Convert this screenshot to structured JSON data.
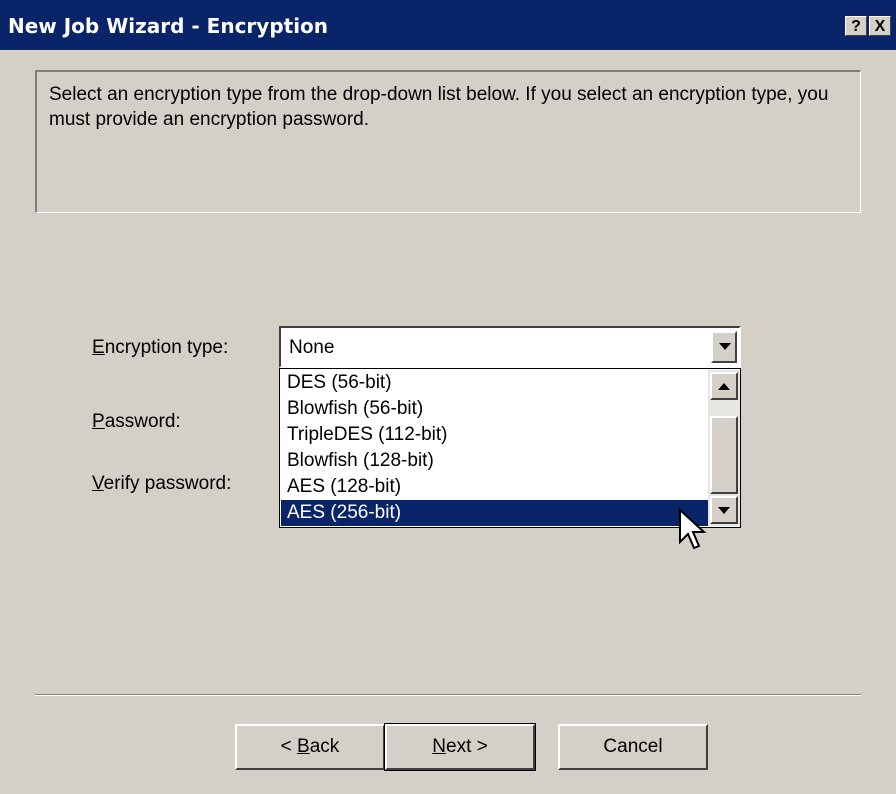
{
  "window": {
    "title": "New Job Wizard - Encryption",
    "help_glyph": "?",
    "close_glyph": "X"
  },
  "info_text": "Select an encryption type from the drop-down list below. If you select an encryption type, you must provide an encryption password.",
  "fields": {
    "encryption_type": {
      "mnemonic": "E",
      "rest": "ncryption type:"
    },
    "password": {
      "mnemonic": "P",
      "rest": "assword:"
    },
    "verify_password": {
      "mnemonic": "V",
      "rest": "erify password:"
    }
  },
  "combo": {
    "value": "None"
  },
  "dropdown": {
    "options": [
      "DES (56-bit)",
      "Blowfish (56-bit)",
      "TripleDES (112-bit)",
      "Blowfish (128-bit)",
      "AES (128-bit)",
      "AES (256-bit)"
    ],
    "highlighted": "AES (256-bit)"
  },
  "buttons": {
    "back": {
      "prefix": "< ",
      "mnemonic": "B",
      "rest": "ack"
    },
    "next": {
      "mnemonic": "N",
      "rest": "ext >"
    },
    "cancel": "Cancel"
  },
  "colors": {
    "titlebar": "#0a246a",
    "face": "#d4d0c8",
    "selection": "#0a246a"
  },
  "icons": [
    "help-icon",
    "close-icon",
    "dropdown-arrow-icon",
    "scroll-up-icon",
    "scroll-down-icon",
    "mouse-pointer-icon"
  ]
}
